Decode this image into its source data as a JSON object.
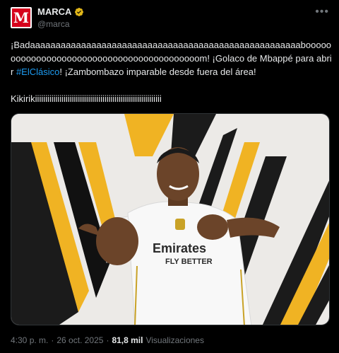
{
  "account": {
    "name": "MARCA",
    "handle": "@marca",
    "avatar_letter": "M"
  },
  "tweet": {
    "line1": "¡Badaaaaaaaaaaaaaaaaaaaaaaaaaaaaaaaaaaaaaaaaaaaaaaaaaaaaaboooooooooooooooooooooooooooooooooooooooooom! ¡Golaco de Mbappé para abrir ",
    "hashtag": "#ElClásico",
    "line1_end": "! ¡Zambombazo imparable desde fuera del área!",
    "line2": "Kikirikiiiiiiiiiiiiiiiiiiiiiiiiiiiiiiiiiiiiiiiiiiiiiiiiiiiiiiiiiiiiii"
  },
  "photo": {
    "jersey_text_1": "Emirates",
    "jersey_text_2": "FLY BETTER"
  },
  "footer": {
    "time": "4:30 p. m.",
    "sep1": "·",
    "date": "26 oct. 2025",
    "sep2": "·",
    "views_count": "81,8 mil",
    "views_label": "Visualizaciones"
  },
  "colors": {
    "accent": "#1d9bf0",
    "verified": "#e2b719",
    "brand": "#d6001c"
  }
}
